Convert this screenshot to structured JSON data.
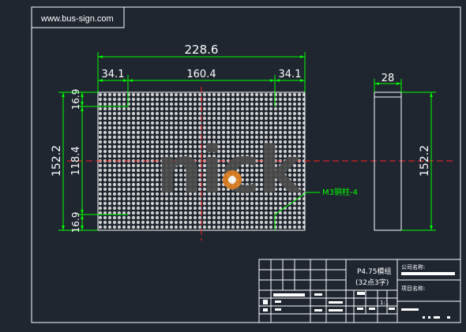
{
  "watermark": {
    "url": "www.bus-sign.com",
    "logo_text": "nick"
  },
  "dimensions": {
    "overall_width": "228.6",
    "left_margin": "34.1",
    "center_span": "160.4",
    "right_margin": "34.1",
    "depth": "28",
    "overall_height": "152.2",
    "inner_height": "118.4",
    "top_margin": "16.9",
    "bottom_margin": "16.9",
    "side_height": "152.2"
  },
  "callout": {
    "label": "M3铜柱-4"
  },
  "title_block": {
    "module_name": "P4.75模组",
    "spec": "(32点3字)",
    "company_label": "公司名称:",
    "project_label": "项目名称:",
    "scale": "1:1"
  },
  "colors": {
    "background": "#1f2630",
    "border": "#ffffff",
    "dimension": "#00ff00",
    "centerline": "#ff2020",
    "led": "#cfcfcf"
  }
}
